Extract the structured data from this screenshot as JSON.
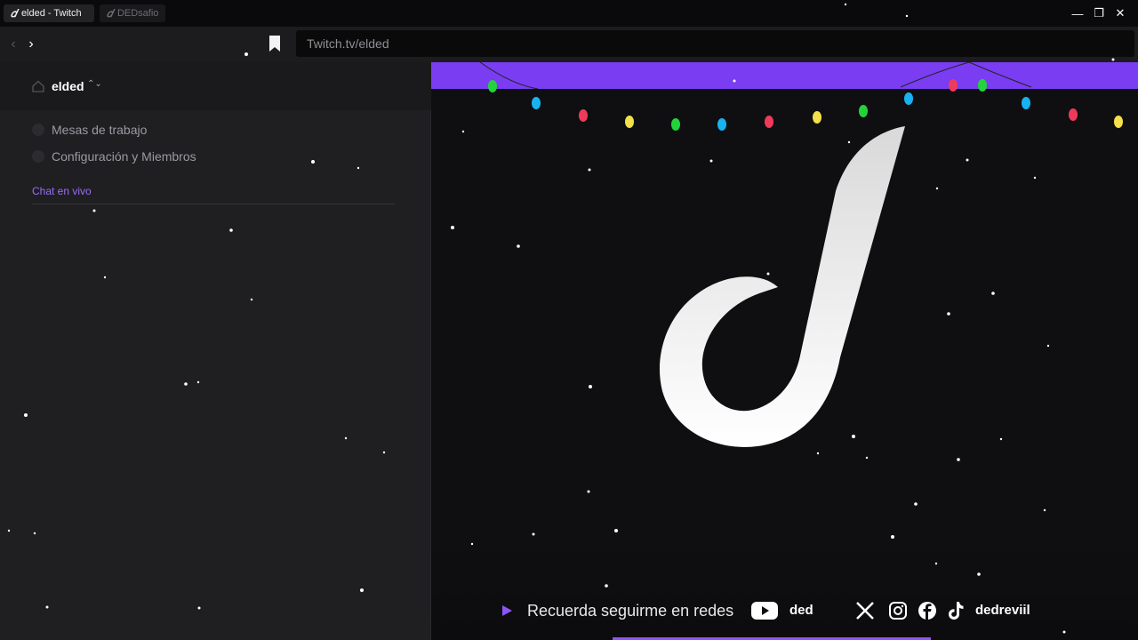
{
  "tabs": [
    {
      "label": "elded - Twitch",
      "active": true
    },
    {
      "label": "DEDsafio",
      "active": false
    }
  ],
  "window_controls": {
    "minimize": "—",
    "maximize": "❐",
    "close": "✕"
  },
  "nav": {
    "back": "‹",
    "forward": "›",
    "url": "Twitch.tv/elded"
  },
  "sidebar": {
    "channel_name": "elded",
    "chevron": "⌃⌄",
    "items": [
      {
        "label": "Mesas de trabajo"
      },
      {
        "label": "Configuración y Miembros"
      }
    ],
    "chat_link": "Chat en vivo"
  },
  "stream": {
    "accent": "#7a3df2",
    "bottom_bar": {
      "text": "Recuerda seguirme en redes",
      "youtube_handle": "ded",
      "social_handle": "dedreviil"
    },
    "logo": "music-note-logo",
    "decoration_colors": [
      "#22d43a",
      "#19b2f0",
      "#ef3a5b",
      "#f3e04a"
    ]
  }
}
